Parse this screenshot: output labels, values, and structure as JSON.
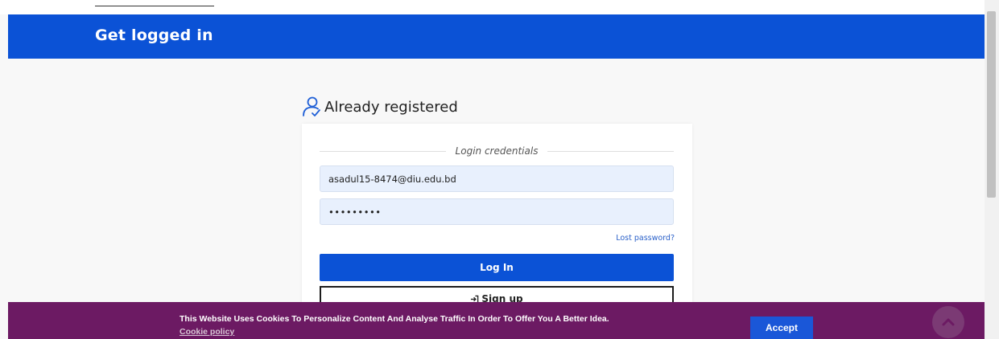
{
  "header": {
    "title": "Get logged in"
  },
  "login_section": {
    "title": "Already registered",
    "icon": "user-check-icon",
    "divider_label": "Login credentials",
    "email_value": "asadul15-8474@diu.edu.bd",
    "password_masked": "•••••••••",
    "lost_password_label": "Lost password?",
    "login_button_label": "Log In",
    "signup_button_label": "Sign up",
    "signup_icon": "sign-in-icon"
  },
  "cookie_banner": {
    "message": "This Website Uses Cookies To Personalize Content And Analyse Traffic In Order To Offer You A Better Idea.",
    "policy_link": "Cookie policy",
    "accept_label": "Accept"
  },
  "colors": {
    "primary": "#0b52d6",
    "cookie_bg": "#6c1a63",
    "field_bg": "#e8f0fd",
    "link": "#2b61c9"
  },
  "scroll_top_icon": "chevron-up-icon"
}
